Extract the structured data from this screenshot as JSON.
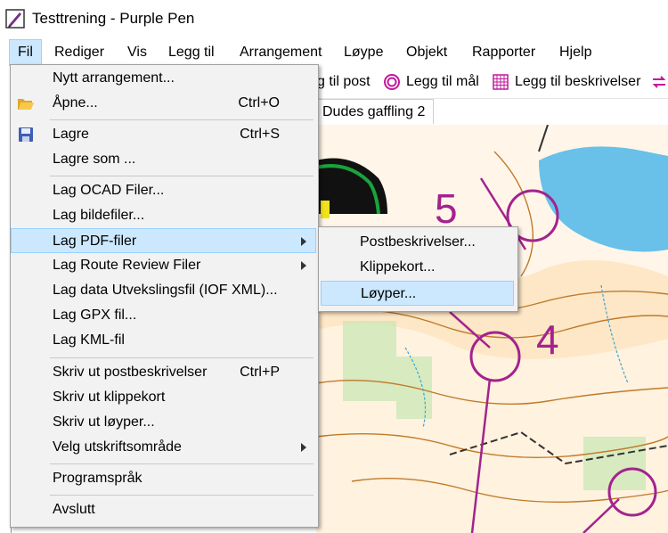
{
  "window": {
    "title": "Testtrening - Purple Pen",
    "icon": "purple-pen-icon"
  },
  "menubar": [
    {
      "label": "Fil",
      "active": true
    },
    {
      "label": "Rediger"
    },
    {
      "label": "Vis"
    },
    {
      "label": "Legg til"
    },
    {
      "label": "Arrangement"
    },
    {
      "label": "Løype"
    },
    {
      "label": "Objekt"
    },
    {
      "label": "Rapporter"
    },
    {
      "label": "Hjelp"
    }
  ],
  "toolbar": {
    "add_control": "g til post",
    "add_finish": "Legg til mål",
    "add_descriptions": "Legg til beskrivelser"
  },
  "tab": {
    "label": "Dudes gaffling 2"
  },
  "map": {
    "label_5": "5",
    "label_4": "4"
  },
  "file_menu": {
    "items": [
      {
        "label": "Nytt arrangement...",
        "shortcut": ""
      },
      {
        "label": "Åpne...",
        "shortcut": "Ctrl+O",
        "icon": "folder-open-icon"
      },
      {
        "label": "Lagre",
        "shortcut": "Ctrl+S",
        "icon": "save-icon"
      },
      {
        "label": "Lagre som ...",
        "shortcut": ""
      },
      {
        "label": "Lag OCAD Filer...",
        "shortcut": ""
      },
      {
        "label": "Lag bildefiler...",
        "shortcut": ""
      },
      {
        "label": "Lag PDF-filer",
        "shortcut": "",
        "submenu": true,
        "highlighted": true
      },
      {
        "label": "Lag Route Review Filer",
        "shortcut": "",
        "submenu": true
      },
      {
        "label": "Lag data Utvekslingsfil (IOF XML)...",
        "shortcut": ""
      },
      {
        "label": "Lag GPX fil...",
        "shortcut": ""
      },
      {
        "label": "Lag KML-fil",
        "shortcut": ""
      },
      {
        "label": "Skriv ut postbeskrivelser",
        "shortcut": "Ctrl+P"
      },
      {
        "label": "Skriv ut klippekort",
        "shortcut": ""
      },
      {
        "label": "Skriv ut løyper...",
        "shortcut": ""
      },
      {
        "label": "Velg utskriftsområde",
        "shortcut": "",
        "submenu": true
      },
      {
        "label": "Programspråk",
        "shortcut": ""
      },
      {
        "label": "Avslutt",
        "shortcut": ""
      }
    ]
  },
  "pdf_submenu": {
    "items": [
      {
        "label": "Postbeskrivelser..."
      },
      {
        "label": "Klippekort..."
      },
      {
        "label": "Løyper...",
        "highlighted": true
      }
    ]
  },
  "colors": {
    "highlight": "#cce8ff",
    "highlight_border": "#99d1ff",
    "course_purple": "#a3238e",
    "menu_bg": "#f2f2f2"
  }
}
